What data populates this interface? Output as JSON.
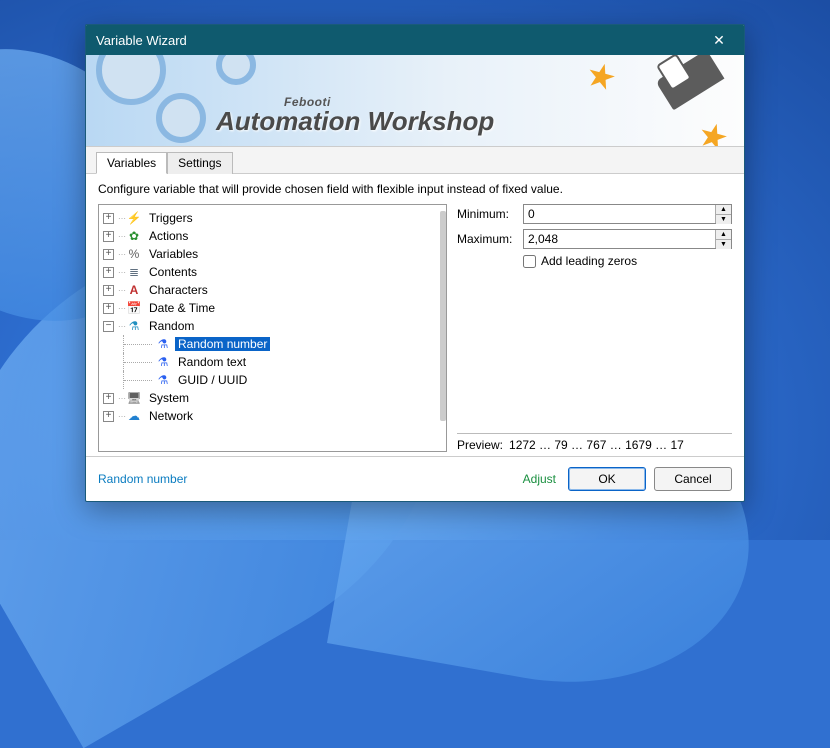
{
  "window": {
    "title": "Variable Wizard"
  },
  "banner": {
    "brand": "Febooti",
    "product": "Automation Workshop"
  },
  "tabs": {
    "variables": "Variables",
    "settings": "Settings"
  },
  "description": "Configure variable that will provide chosen field with flexible input instead of fixed value.",
  "tree": {
    "triggers": "Triggers",
    "actions": "Actions",
    "variables": "Variables",
    "contents": "Contents",
    "characters": "Characters",
    "datetime": "Date & Time",
    "random": "Random",
    "random_number": "Random number",
    "random_text": "Random text",
    "guid": "GUID / UUID",
    "system": "System",
    "network": "Network"
  },
  "fields": {
    "min_label": "Minimum:",
    "max_label": "Maximum:",
    "min_value": "0",
    "max_value": "2,048",
    "leading_zeros": "Add leading zeros"
  },
  "preview": {
    "label": "Preview:",
    "value": "1272 … 79 … 767 … 1679 … 17"
  },
  "footer": {
    "status": "Random number",
    "adjust": "Adjust",
    "ok": "OK",
    "cancel": "Cancel"
  }
}
